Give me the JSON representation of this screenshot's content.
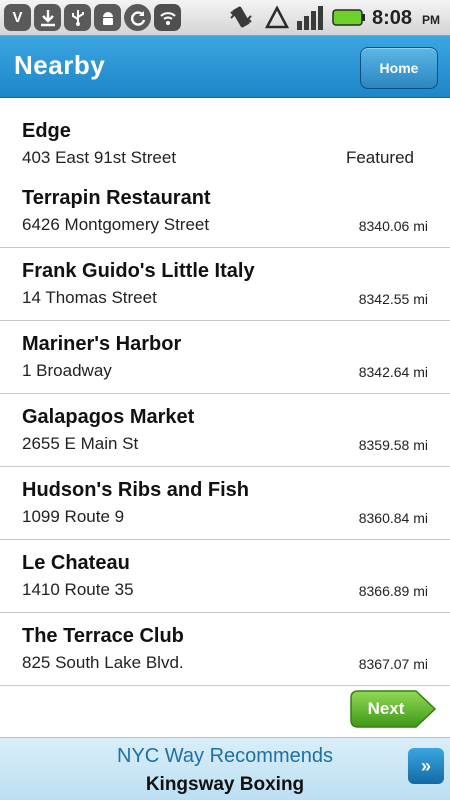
{
  "status_bar": {
    "icons": [
      "v-app-icon",
      "download-icon",
      "usb-icon",
      "android-icon",
      "sync-icon",
      "wifi-icon",
      "vibrate-icon",
      "no-signal-icon",
      "signal-bars-icon",
      "battery-icon"
    ],
    "time": "8:08",
    "ampm": "PM"
  },
  "header": {
    "title": "Nearby",
    "home_label": "Home"
  },
  "places": [
    {
      "name": "Edge",
      "address": "403 East 91st Street",
      "distance": "Featured"
    },
    {
      "name": "Terrapin Restaurant",
      "address": "6426 Montgomery Street",
      "distance": "8340.06 mi"
    },
    {
      "name": "Frank Guido's Little Italy",
      "address": "14 Thomas Street",
      "distance": "8342.55 mi"
    },
    {
      "name": "Mariner's Harbor",
      "address": "1 Broadway",
      "distance": "8342.64 mi"
    },
    {
      "name": "Galapagos Market",
      "address": "2655 E Main St",
      "distance": "8359.58 mi"
    },
    {
      "name": "Hudson's Ribs and Fish",
      "address": "1099 Route 9",
      "distance": "8360.84 mi"
    },
    {
      "name": "Le Chateau",
      "address": "1410 Route 35",
      "distance": "8366.89 mi"
    },
    {
      "name": "The Terrace Club",
      "address": "825 South Lake Blvd.",
      "distance": "8367.07 mi"
    }
  ],
  "pagination": {
    "next_label": "Next"
  },
  "ad": {
    "line1": "NYC Way Recommends",
    "line2": "Kingsway Boxing"
  },
  "colors": {
    "header_blue": "#2a95d4",
    "next_green": "#5bb52a",
    "ad_text_blue": "#1f6fa6"
  }
}
